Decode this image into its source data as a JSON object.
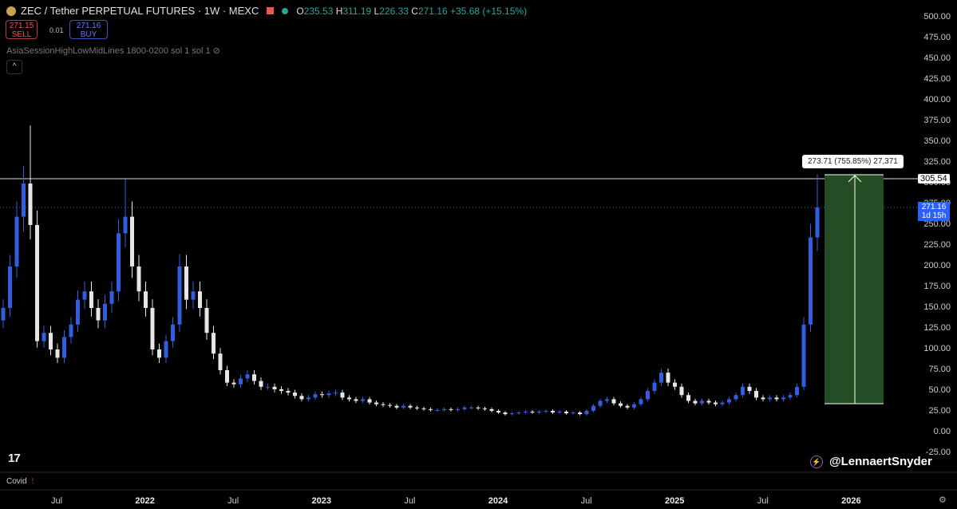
{
  "header": {
    "title": "ZEC / Tether PERPETUAL FUTURES · 1W · MEXC",
    "open_label": "O",
    "open": "235.53",
    "high_label": "H",
    "high": "311.19",
    "low_label": "L",
    "low": "226.33",
    "close_label": "C",
    "close": "271.16",
    "change": "+35.68 (+15.15%)"
  },
  "trade": {
    "sell_price": "271.15",
    "sell_label": "SELL",
    "spread": "0.01",
    "buy_price": "271.16",
    "buy_label": "BUY"
  },
  "indicator": {
    "label": "AsiaSessionHighLowMidLines 1800-0200 sol 1 sol 1"
  },
  "collapse_icon": "^",
  "price_axis": [
    "500.00",
    "475.00",
    "450.00",
    "425.00",
    "400.00",
    "375.00",
    "350.00",
    "325.00",
    "300.00",
    "275.00",
    "250.00",
    "225.00",
    "200.00",
    "175.00",
    "150.00",
    "125.00",
    "100.00",
    "75.00",
    "50.00",
    "25.00",
    "0.00",
    "-25.00"
  ],
  "time_axis": [
    {
      "label": "Jul",
      "year": false
    },
    {
      "label": "2022",
      "year": true
    },
    {
      "label": "Jul",
      "year": false
    },
    {
      "label": "2023",
      "year": true
    },
    {
      "label": "Jul",
      "year": false
    },
    {
      "label": "2024",
      "year": true
    },
    {
      "label": "Jul",
      "year": false
    },
    {
      "label": "2025",
      "year": true
    },
    {
      "label": "Jul",
      "year": false
    },
    {
      "label": "2026",
      "year": true
    }
  ],
  "price_tag": {
    "price": "271.16",
    "countdown": "1d 15h"
  },
  "hline": {
    "label": "305.54"
  },
  "measure": {
    "label": "273.71 (755.85%) 27,371"
  },
  "pane": {
    "label": "Covid",
    "icon": "!"
  },
  "watermark": {
    "author": "@LennaertSnyder",
    "logo": "TV"
  },
  "colors": {
    "up": "#2f5fe0",
    "down": "#e6e6e6",
    "bg": "#000000",
    "box": "#244d24"
  },
  "chart_data": {
    "type": "candlestick",
    "title": "ZEC / Tether PERPETUAL FUTURES · 1W · MEXC",
    "interval": "bi-weekly approximation of weekly candles, Mar 2021 – Oct 2025",
    "ylim": [
      -25,
      500
    ],
    "closes": [
      150,
      200,
      260,
      300,
      250,
      110,
      120,
      100,
      90,
      115,
      130,
      160,
      170,
      150,
      135,
      155,
      170,
      240,
      260,
      200,
      170,
      150,
      100,
      90,
      110,
      130,
      200,
      160,
      170,
      150,
      120,
      95,
      75,
      60,
      58,
      65,
      70,
      62,
      55,
      55,
      52,
      50,
      48,
      44,
      40,
      42,
      46,
      45,
      47,
      48,
      42,
      40,
      38,
      40,
      36,
      34,
      33,
      32,
      30,
      32,
      30,
      29,
      28,
      27,
      27,
      28,
      27,
      28,
      30,
      30,
      29,
      28,
      26,
      24,
      22,
      23,
      24,
      25,
      24,
      25,
      26,
      24,
      25,
      23,
      24,
      22,
      26,
      32,
      38,
      40,
      35,
      32,
      30,
      34,
      40,
      50,
      60,
      72,
      60,
      55,
      45,
      38,
      35,
      38,
      36,
      34,
      36,
      40,
      45,
      55,
      50,
      42,
      40,
      42,
      40,
      42,
      45,
      55,
      130,
      235,
      271.16
    ],
    "notable_highs": {
      "4": 370,
      "18": 305,
      "26": 215,
      "120": 311.19
    },
    "horizontal_line": 305.54,
    "measure_range": {
      "from": 35.5,
      "to": 309.2,
      "change": 273.71,
      "percent": 755.85,
      "bars": 27371
    }
  }
}
